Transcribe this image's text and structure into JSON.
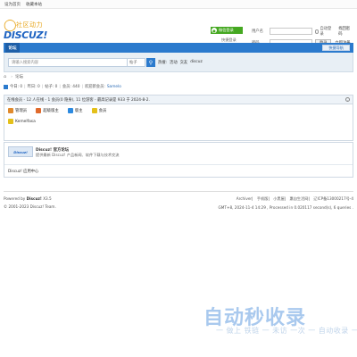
{
  "topbar": {
    "items": [
      "设为首页",
      "收藏本站"
    ]
  },
  "logo": {
    "cn": "社区动力",
    "en": "DISCUZ!"
  },
  "wechat": {
    "button": "微信登录",
    "quick_login": "快捷登录"
  },
  "login": {
    "username_label": "用户名",
    "password_label": "密码",
    "remember": "自动登录",
    "forgot": "找回密码",
    "login_button": "登录",
    "register_button": "立即注册"
  },
  "nav": {
    "home": "论坛",
    "quick": "快捷导航"
  },
  "search": {
    "placeholder": "请输入搜索内容",
    "type": "帖子",
    "hot_label": "热搜:",
    "hot_terms": [
      "活动",
      "交友",
      "discuz"
    ]
  },
  "breadcrumb": {
    "home_icon": "home-icon",
    "sep": "›",
    "label": "论坛"
  },
  "stats": {
    "today": "今日: 0",
    "yesterday": "昨日: 0",
    "posts": "帖子: 0",
    "members": "会员: 440",
    "newest_prefix": "欢迎新会员:",
    "newest_member": "Samelo"
  },
  "online": {
    "title": "在线会员 - 12 人在线 - 1 会员(0 隐身), 11 位游客 - 最高记录是 933 于 2024-8-2.",
    "groups": [
      {
        "label": "管理员",
        "color": "#e08a2c"
      },
      {
        "label": "超级版主",
        "color": "#e06a2c"
      },
      {
        "label": "版主",
        "color": "#2c8ae0"
      },
      {
        "label": "会员",
        "color": "#e4c01a"
      }
    ],
    "user": "Kemelfasa"
  },
  "links": {
    "logo_text": "Discuz!",
    "title": "Discuz! 官方论坛",
    "desc": "提供最新 Discuz! 产品新闻、软件下载与技术交流",
    "text": "Discuz! 应用中心"
  },
  "footer": {
    "powered_prefix": "Powered by",
    "powered_brand": "Discuz!",
    "version": "X3.5",
    "copyright": "© 2001-2023 Discuz! Team.",
    "links": [
      "Archiver",
      "手机版",
      "小黑屋",
      "惠自生活网",
      "辽ICP备13000217号-4"
    ],
    "gmt": "GMT+8, 2024-11-4 14:29 , Processed in 0.020117 second(s), 6 queries ."
  },
  "watermark": {
    "logo": "自动秒收录",
    "sub": "一 做上 铁链 一 未访 一次 一 自动收录 一"
  }
}
